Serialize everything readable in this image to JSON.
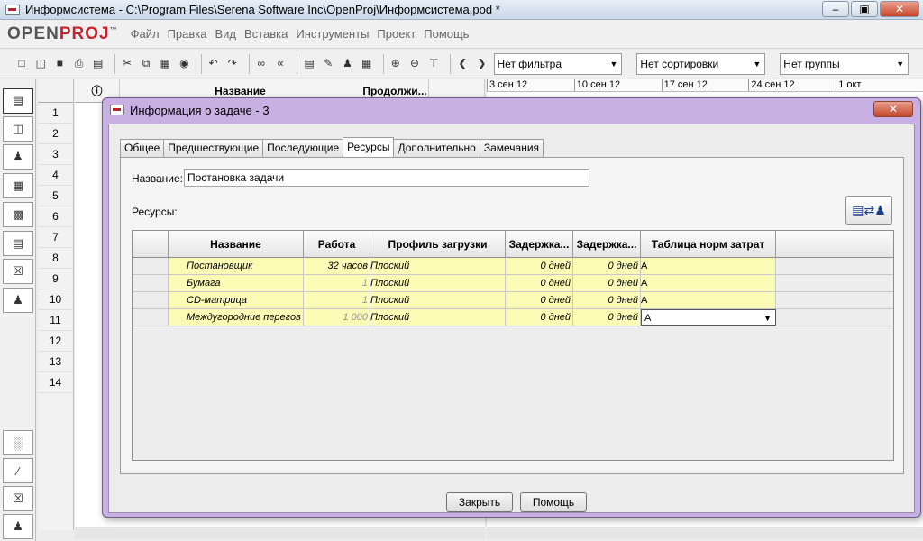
{
  "window": {
    "title": "Информсистема - C:\\Program Files\\Serena Software Inc\\OpenProj\\Информсистема.pod *"
  },
  "logo": {
    "open": "OPEN",
    "proj": "PROJ",
    "tm": "™"
  },
  "menu": [
    "Файл",
    "Правка",
    "Вид",
    "Вставка",
    "Инструменты",
    "Проект",
    "Помощь"
  ],
  "toolbar": {
    "filter": "Нет фильтра",
    "sort": "Нет сортировки",
    "group": "Нет группы"
  },
  "grid": {
    "headers": {
      "name": "Название",
      "duration": "Продолжи..."
    },
    "rows": [
      "1",
      "2",
      "3",
      "4",
      "5",
      "6",
      "7",
      "8",
      "9",
      "10",
      "11",
      "12",
      "13",
      "14"
    ]
  },
  "gantt": {
    "weeks": [
      "3 сен 12",
      "10 сен 12",
      "17 сен 12",
      "24 сен 12",
      "1 окт"
    ]
  },
  "dialog": {
    "title": "Информация о задаче - 3",
    "tabs": [
      "Общее",
      "Предшествующие",
      "Последующие",
      "Ресурсы",
      "Дополнительно",
      "Замечания"
    ],
    "active_tab": "Ресурсы",
    "name_label": "Название:",
    "name_value": "Постановка задачи",
    "resources_label": "Ресурсы:",
    "columns": [
      "Название",
      "Работа",
      "Профиль загрузки",
      "Задержка...",
      "Задержка...",
      "Таблица норм затрат"
    ],
    "rows": [
      {
        "name": "Постановщик",
        "work": "32 часов",
        "profile": "Плоский",
        "delay1": "0 дней",
        "delay2": "0 дней",
        "table": "A"
      },
      {
        "name": "Бумага",
        "work": "1",
        "profile": "Плоский",
        "delay1": "0 дней",
        "delay2": "0 дней",
        "table": "A"
      },
      {
        "name": "CD-матрица",
        "work": "1",
        "profile": "Плоский",
        "delay1": "0 дней",
        "delay2": "0 дней",
        "table": "A"
      },
      {
        "name": "Междугородние перегов",
        "work": "1 000",
        "profile": "Плоский",
        "delay1": "0 дней",
        "delay2": "0 дней",
        "table": "A"
      }
    ],
    "buttons": {
      "close": "Закрыть",
      "help": "Помощь"
    }
  }
}
